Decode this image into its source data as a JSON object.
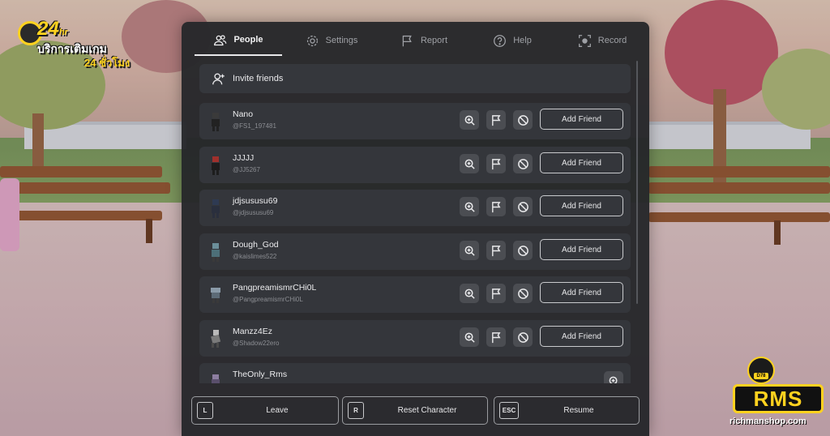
{
  "tabs": [
    {
      "label": "People",
      "icon": "people-icon",
      "active": true
    },
    {
      "label": "Settings",
      "icon": "gear-icon",
      "active": false
    },
    {
      "label": "Report",
      "icon": "flag-icon",
      "active": false
    },
    {
      "label": "Help",
      "icon": "help-icon",
      "active": false
    },
    {
      "label": "Record",
      "icon": "record-icon",
      "active": false
    }
  ],
  "invite": {
    "label": "Invite friends",
    "icon": "add-person-icon"
  },
  "players": [
    {
      "name": "Nano",
      "handle": "@FS1_197481",
      "action": "Add Friend"
    },
    {
      "name": "JJJJJ",
      "handle": "@JJ5267",
      "action": "Add Friend"
    },
    {
      "name": "jdjsususu69",
      "handle": "@jdjsususu69",
      "action": "Add Friend"
    },
    {
      "name": "Dough_God",
      "handle": "@kaislimes522",
      "action": "Add Friend"
    },
    {
      "name": "PangpreamismrCHi0L",
      "handle": "@PangpreamismrCHi0L",
      "action": "Add Friend"
    },
    {
      "name": "Manzz4Ez",
      "handle": "@Shadow22ero",
      "action": "Add Friend"
    },
    {
      "name": "TheOnly_Rms",
      "handle": "",
      "action": ""
    }
  ],
  "row_icons": [
    "zoom-in-icon",
    "flag-icon",
    "block-icon"
  ],
  "bottom_buttons": [
    {
      "key": "L",
      "label": "Leave"
    },
    {
      "key": "R",
      "label": "Reset Character"
    },
    {
      "key": "ESC",
      "label": "Resume"
    }
  ],
  "badge_24": {
    "number": "24",
    "unit": "hr",
    "line1": "บริการเติมเกม",
    "line2": "24 ชั่วโมง"
  },
  "rms_logo": {
    "text": "RMS",
    "url": "richmanshop.com",
    "tag": "D78"
  },
  "colors": {
    "panel": "#25262a",
    "row": "#34363b",
    "icon_button": "#4b4d52",
    "accent_yellow": "#ffd21f"
  }
}
